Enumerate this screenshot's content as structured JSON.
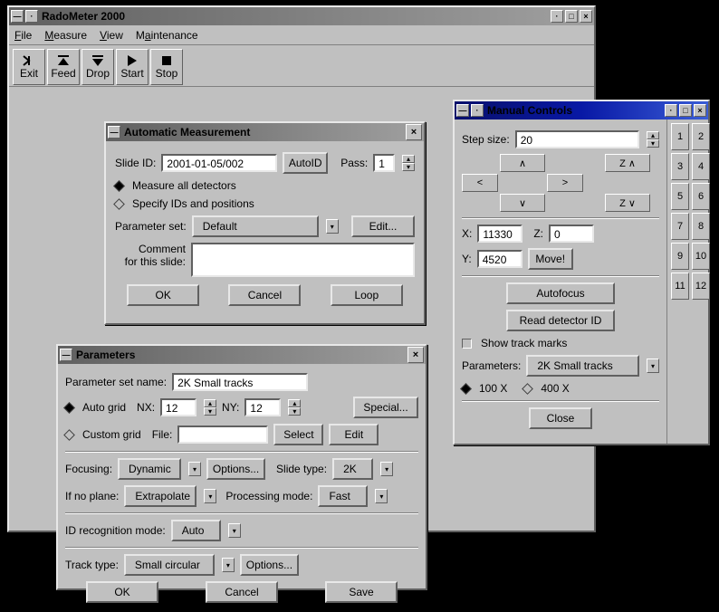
{
  "main": {
    "title": "RadoMeter 2000",
    "menu": {
      "file": "File",
      "measure": "Measure",
      "view": "View",
      "maintenance": "Maintenance"
    },
    "toolbar": {
      "exit": "Exit",
      "feed": "Feed",
      "drop": "Drop",
      "start": "Start",
      "stop": "Stop"
    }
  },
  "auto": {
    "title": "Automatic Measurement",
    "slide_id_lbl": "Slide ID:",
    "slide_id": "2001-01-05/002",
    "autoid": "AutoID",
    "pass_lbl": "Pass:",
    "pass": "1",
    "measure_all": "Measure all detectors",
    "specify": "Specify IDs and positions",
    "param_set_lbl": "Parameter set:",
    "param_set": "Default",
    "edit": "Edit...",
    "comment_lbl1": "Comment",
    "comment_lbl2": "for this slide:",
    "ok": "OK",
    "cancel": "Cancel",
    "loop": "Loop"
  },
  "params": {
    "title": "Parameters",
    "name_lbl": "Parameter set name:",
    "name": "2K Small tracks",
    "auto_grid": "Auto grid",
    "nx_lbl": "NX:",
    "nx": "12",
    "ny_lbl": "NY:",
    "ny": "12",
    "special": "Special...",
    "custom_grid": "Custom grid",
    "file_lbl": "File:",
    "select": "Select",
    "edit": "Edit",
    "focusing_lbl": "Focusing:",
    "focusing": "Dynamic",
    "options": "Options...",
    "slide_type_lbl": "Slide type:",
    "slide_type": "2K",
    "if_no_plane_lbl": "If no plane:",
    "if_no_plane": "Extrapolate",
    "processing_lbl": "Processing mode:",
    "processing": "Fast",
    "id_mode_lbl": "ID recognition mode:",
    "id_mode": "Auto",
    "track_type_lbl": "Track type:",
    "track_type": "Small circular",
    "ok": "OK",
    "cancel": "Cancel",
    "save": "Save"
  },
  "manual": {
    "title": "Manual Controls",
    "step_lbl": "Step size:",
    "step": "20",
    "up": "∧",
    "down": "∨",
    "left": "<",
    "right": ">",
    "zup": "Z ∧",
    "zdown": "Z ∨",
    "x_lbl": "X:",
    "x": "11330",
    "z_lbl": "Z:",
    "z": "0",
    "y_lbl": "Y:",
    "y": "4520",
    "move": "Move!",
    "autofocus": "Autofocus",
    "read_id": "Read detector ID",
    "show_marks": "Show track marks",
    "params_lbl": "Parameters:",
    "params": "2K Small tracks",
    "mag100": "100 X",
    "mag400": "400 X",
    "close": "Close",
    "nums": [
      "1",
      "2",
      "3",
      "4",
      "5",
      "6",
      "7",
      "8",
      "9",
      "10",
      "11",
      "12"
    ]
  }
}
